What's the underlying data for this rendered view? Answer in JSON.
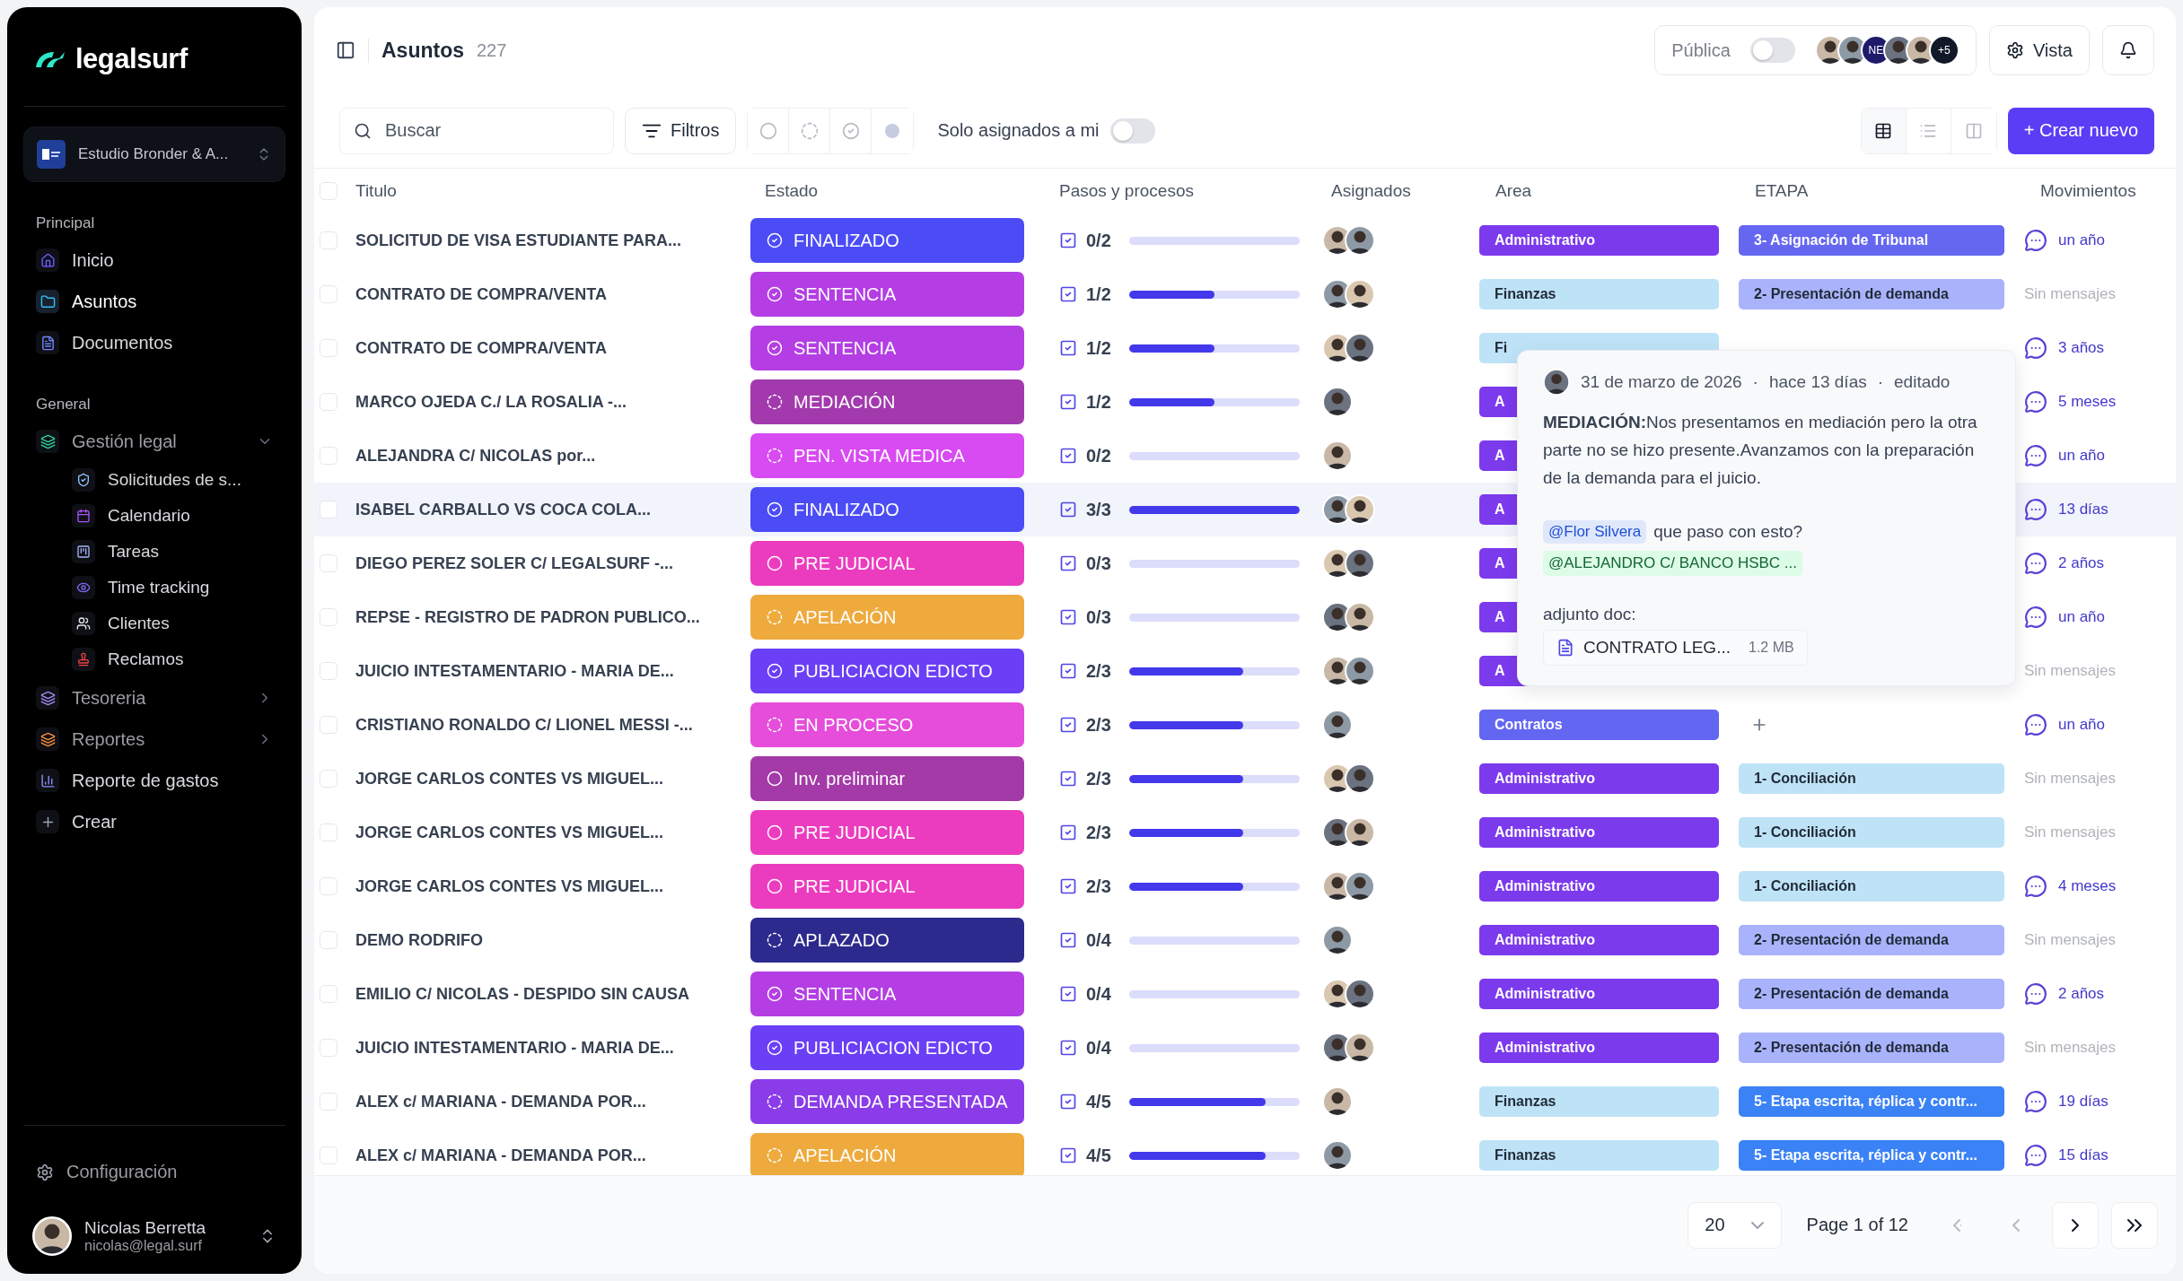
{
  "sidebar": {
    "brand": "legalsurf",
    "workspace": "Estudio Bronder & A...",
    "sections": [
      {
        "title": "Principal",
        "items": [
          {
            "label": "Inicio",
            "selected": false
          },
          {
            "label": "Asuntos",
            "selected": true
          },
          {
            "label": "Documentos",
            "selected": false
          }
        ]
      },
      {
        "title": "General",
        "items": [
          {
            "label": "Gestión legal",
            "selected": false,
            "expanded": true,
            "children": [
              {
                "label": "Solicitudes de s...",
                "selected": false
              },
              {
                "label": "Calendario",
                "selected": false
              },
              {
                "label": "Tareas",
                "selected": false
              },
              {
                "label": "Time tracking",
                "selected": false
              },
              {
                "label": "Clientes",
                "selected": false
              },
              {
                "label": "Reclamos",
                "selected": false
              }
            ]
          },
          {
            "label": "Tesoreria",
            "selected": false,
            "expanded": false
          },
          {
            "label": "Reportes",
            "selected": false,
            "expanded": false
          },
          {
            "label": "Reporte de gastos",
            "selected": false
          },
          {
            "label": "Crear",
            "selected": false
          }
        ]
      }
    ],
    "settings": "Configuración",
    "user_name": "Nicolas Berretta",
    "user_email": "nicolas@legal.surf"
  },
  "header": {
    "title": "Asuntos",
    "count": "227",
    "public_label": "Pública",
    "public_on": false,
    "members": [
      {
        "kind": "photo"
      },
      {
        "kind": "photo"
      },
      {
        "kind": "initials",
        "label": "NE"
      },
      {
        "kind": "photo"
      },
      {
        "kind": "photo"
      },
      {
        "kind": "more",
        "label": "+5"
      }
    ],
    "view_button": "Vista"
  },
  "toolbar": {
    "search_placeholder": "Buscar",
    "filters_button": "Filtros",
    "status_filters": [
      {
        "kind": "open"
      },
      {
        "kind": "pending"
      },
      {
        "kind": "done"
      },
      {
        "kind": "dot"
      }
    ],
    "only_mine_label": "Solo asignados a mi",
    "only_mine_on": false,
    "views": [
      {
        "kind": "table",
        "selected": true
      },
      {
        "kind": "list",
        "selected": false
      },
      {
        "kind": "board",
        "selected": false
      }
    ],
    "create_button": "+ Crear nuevo"
  },
  "table": {
    "select_all_checked": false,
    "columns": [
      "Titulo",
      "Estado",
      "Pasos y procesos",
      "Asignados",
      "Area",
      "ETAPA",
      "Movimientos"
    ],
    "rows": [
      {
        "title": "SOLICITUD DE VISA ESTUDIANTE PARA...",
        "checked": false,
        "highlighted": false,
        "status": {
          "label": "FINALIZADO",
          "kind": "done",
          "color": "#4b4cf6"
        },
        "steps": "0/2",
        "level": 0,
        "assignees": [
          {
            "kind": "photo"
          },
          {
            "kind": "photo"
          }
        ],
        "area": {
          "label": "Administrativo",
          "kind": "admin"
        },
        "etapa": {
          "label": "3- Asignación de Tribunal",
          "kind": "tribunal"
        },
        "movement": {
          "label": "un año",
          "kind": "messages"
        }
      },
      {
        "title": "CONTRATO DE COMPRA/VENTA",
        "checked": false,
        "highlighted": false,
        "status": {
          "label": "SENTENCIA",
          "kind": "done",
          "color": "#b43ee3"
        },
        "steps": "1/2",
        "level": 0.5,
        "assignees": [
          {
            "kind": "photo"
          },
          {
            "kind": "photo"
          }
        ],
        "area": {
          "label": "Finanzas",
          "kind": "finanzas"
        },
        "etapa": {
          "label": "2- Presentación de demanda",
          "kind": "demanda"
        },
        "movement": {
          "label": "Sin mensajes",
          "kind": "none"
        }
      },
      {
        "title": "CONTRATO DE COMPRA/VENTA",
        "checked": false,
        "highlighted": false,
        "status": {
          "label": "SENTENCIA",
          "kind": "done",
          "color": "#b43ee3"
        },
        "steps": "1/2",
        "level": 0.5,
        "assignees": [
          {
            "kind": "photo"
          },
          {
            "kind": "photo"
          }
        ],
        "area": {
          "label": "Fi",
          "kind": "finanzas"
        },
        "movement": {
          "label": "3 años",
          "kind": "messages"
        }
      },
      {
        "title": "MARCO OJEDA C./ LA ROSALIA -...",
        "checked": false,
        "highlighted": false,
        "status": {
          "label": "MEDIACIÓN",
          "kind": "pending",
          "color": "#a23aad"
        },
        "steps": "1/2",
        "level": 0.5,
        "assignees": [
          {
            "kind": "photo"
          }
        ],
        "area": {
          "label": "A",
          "kind": "admin"
        },
        "movement": {
          "label": "5 meses",
          "kind": "messages"
        }
      },
      {
        "title": "ALEJANDRA C/ NICOLAS por...",
        "checked": false,
        "highlighted": false,
        "status": {
          "label": "PEN. VISTA MEDICA",
          "kind": "pending",
          "color": "#d84af2"
        },
        "steps": "0/2",
        "level": 0,
        "assignees": [
          {
            "kind": "photo"
          }
        ],
        "area": {
          "label": "A",
          "kind": "admin"
        },
        "movement": {
          "label": "un año",
          "kind": "messages"
        }
      },
      {
        "title": "ISABEL CARBALLO VS COCA COLA...",
        "checked": false,
        "highlighted": true,
        "status": {
          "label": "FINALIZADO",
          "kind": "done",
          "color": "#4b4cf6"
        },
        "steps": "3/3",
        "level": 1,
        "assignees": [
          {
            "kind": "photo"
          },
          {
            "kind": "photo"
          }
        ],
        "area": {
          "label": "A",
          "kind": "admin"
        },
        "movement": {
          "label": "13 días",
          "kind": "messages"
        }
      },
      {
        "title": "DIEGO PEREZ SOLER C/ LEGALSURF -...",
        "checked": false,
        "highlighted": false,
        "status": {
          "label": "PRE JUDICIAL",
          "kind": "open",
          "color": "#eb3cbf"
        },
        "steps": "0/3",
        "level": 0,
        "assignees": [
          {
            "kind": "photo"
          },
          {
            "kind": "photo"
          }
        ],
        "area": {
          "label": "A",
          "kind": "admin"
        },
        "movement": {
          "label": "2 años",
          "kind": "messages"
        }
      },
      {
        "title": "REPSE - REGISTRO DE PADRON PUBLICO...",
        "checked": false,
        "highlighted": false,
        "status": {
          "label": "APELACIÓN",
          "kind": "pending",
          "color": "#eeaa3d"
        },
        "steps": "0/3",
        "level": 0,
        "assignees": [
          {
            "kind": "photo"
          },
          {
            "kind": "photo"
          }
        ],
        "area": {
          "label": "A",
          "kind": "admin"
        },
        "movement": {
          "label": "un año",
          "kind": "messages"
        }
      },
      {
        "title": "JUICIO INTESTAMENTARIO - MARIA DE...",
        "checked": false,
        "highlighted": false,
        "status": {
          "label": "PUBLICIACION EDICTO",
          "kind": "done",
          "color": "#6a3ff6"
        },
        "steps": "2/3",
        "level": 0.667,
        "assignees": [
          {
            "kind": "photo"
          },
          {
            "kind": "photo"
          }
        ],
        "area": {
          "label": "A",
          "kind": "admin"
        },
        "movement": {
          "label": "Sin mensajes",
          "kind": "none"
        }
      },
      {
        "title": "CRISTIANO RONALDO C/ LIONEL MESSI -...",
        "checked": false,
        "highlighted": false,
        "status": {
          "label": "EN PROCESO",
          "kind": "pending",
          "color": "#e64ddb"
        },
        "steps": "2/3",
        "level": 0.667,
        "assignees": [
          {
            "kind": "photo"
          }
        ],
        "area": {
          "label": "Contratos",
          "kind": "contratos"
        },
        "etapa": {
          "kind": "add"
        },
        "movement": {
          "label": "un año",
          "kind": "messages"
        }
      },
      {
        "title": "JORGE CARLOS CONTES VS MIGUEL...",
        "checked": false,
        "highlighted": false,
        "status": {
          "label": "Inv. preliminar",
          "kind": "open",
          "color": "#a43aa8"
        },
        "steps": "2/3",
        "level": 0.667,
        "assignees": [
          {
            "kind": "photo"
          },
          {
            "kind": "photo"
          }
        ],
        "area": {
          "label": "Administrativo",
          "kind": "admin"
        },
        "etapa": {
          "label": "1- Conciliación",
          "kind": "conciliacion"
        },
        "movement": {
          "label": "Sin mensajes",
          "kind": "none"
        }
      },
      {
        "title": "JORGE CARLOS CONTES VS MIGUEL...",
        "checked": false,
        "highlighted": false,
        "status": {
          "label": "PRE JUDICIAL",
          "kind": "open",
          "color": "#eb3cbf"
        },
        "steps": "2/3",
        "level": 0.667,
        "assignees": [
          {
            "kind": "photo"
          },
          {
            "kind": "photo"
          }
        ],
        "area": {
          "label": "Administrativo",
          "kind": "admin"
        },
        "etapa": {
          "label": "1- Conciliación",
          "kind": "conciliacion"
        },
        "movement": {
          "label": "Sin mensajes",
          "kind": "none"
        }
      },
      {
        "title": "JORGE CARLOS CONTES VS MIGUEL...",
        "checked": false,
        "highlighted": false,
        "status": {
          "label": "PRE JUDICIAL",
          "kind": "open",
          "color": "#eb3cbf"
        },
        "steps": "2/3",
        "level": 0.667,
        "assignees": [
          {
            "kind": "photo"
          },
          {
            "kind": "photo"
          }
        ],
        "area": {
          "label": "Administrativo",
          "kind": "admin"
        },
        "etapa": {
          "label": "1- Conciliación",
          "kind": "conciliacion"
        },
        "movement": {
          "label": "4 meses",
          "kind": "messages"
        }
      },
      {
        "title": "DEMO RODRIFO",
        "checked": false,
        "highlighted": false,
        "status": {
          "label": "APLAZADO",
          "kind": "pending",
          "color": "#2d2a8e"
        },
        "steps": "0/4",
        "level": 0,
        "assignees": [
          {
            "kind": "photo"
          }
        ],
        "area": {
          "label": "Administrativo",
          "kind": "admin"
        },
        "etapa": {
          "label": "2- Presentación de demanda",
          "kind": "demanda"
        },
        "movement": {
          "label": "Sin mensajes",
          "kind": "none"
        }
      },
      {
        "title": "EMILIO C/ NICOLAS - DESPIDO SIN CAUSA",
        "checked": false,
        "highlighted": false,
        "status": {
          "label": "SENTENCIA",
          "kind": "done",
          "color": "#b43ee3"
        },
        "steps": "0/4",
        "level": 0,
        "assignees": [
          {
            "kind": "photo"
          },
          {
            "kind": "photo"
          }
        ],
        "area": {
          "label": "Administrativo",
          "kind": "admin"
        },
        "etapa": {
          "label": "2- Presentación de demanda",
          "kind": "demanda"
        },
        "movement": {
          "label": "2 años",
          "kind": "messages"
        }
      },
      {
        "title": "JUICIO INTESTAMENTARIO - MARIA DE...",
        "checked": false,
        "highlighted": false,
        "status": {
          "label": "PUBLICIACION EDICTO",
          "kind": "done",
          "color": "#6a3ff6"
        },
        "steps": "0/4",
        "level": 0,
        "assignees": [
          {
            "kind": "photo"
          },
          {
            "kind": "photo"
          }
        ],
        "area": {
          "label": "Administrativo",
          "kind": "admin"
        },
        "etapa": {
          "label": "2- Presentación de demanda",
          "kind": "demanda"
        },
        "movement": {
          "label": "Sin mensajes",
          "kind": "none"
        }
      },
      {
        "title": "ALEX c/ MARIANA - DEMANDA POR...",
        "checked": false,
        "highlighted": false,
        "status": {
          "label": "DEMANDA PRESENTADA",
          "kind": "pending",
          "color": "#8a3ce9"
        },
        "steps": "4/5",
        "level": 0.8,
        "assignees": [
          {
            "kind": "photo"
          }
        ],
        "area": {
          "label": "Finanzas",
          "kind": "finanzas"
        },
        "etapa": {
          "label": "5- Etapa escrita, réplica y contr...",
          "kind": "escrita"
        },
        "movement": {
          "label": "19 días",
          "kind": "messages"
        }
      },
      {
        "title": "ALEX c/ MARIANA - DEMANDA POR...",
        "checked": false,
        "highlighted": false,
        "status": {
          "label": "APELACIÓN",
          "kind": "pending",
          "color": "#eeaa3d"
        },
        "steps": "4/5",
        "level": 0.8,
        "assignees": [
          {
            "kind": "photo"
          }
        ],
        "area": {
          "label": "Finanzas",
          "kind": "finanzas"
        },
        "etapa": {
          "label": "5- Etapa escrita, réplica y contr...",
          "kind": "escrita"
        },
        "movement": {
          "label": "15 días",
          "kind": "messages"
        }
      }
    ]
  },
  "popover": {
    "date": "31 de marzo de 2026",
    "separator_1": "·",
    "ago": "hace 13 días",
    "separator_2": "·",
    "edited": "editado",
    "text": "**MEDIACIÓN:**Nos presentamos en mediación pero la otra parte no se hizo presente.Avanzamos con la preparación de la demanda para el juicio.",
    "mention": "@Flor Silvera",
    "mention_text": "que paso con esto?",
    "case_chip": "@ALEJANDRO C/ BANCO HSBC ...",
    "attachment_label": "adjunto doc:",
    "file_name": "CONTRATO LEG...",
    "file_size": "1.2 MB"
  },
  "pagination": {
    "page_size": "20",
    "label": "Page 1 of 12",
    "buttons": [
      {
        "kind": "first",
        "disabled": true
      },
      {
        "kind": "prev",
        "disabled": true
      },
      {
        "kind": "next",
        "disabled": false
      },
      {
        "kind": "last",
        "disabled": false
      }
    ]
  }
}
